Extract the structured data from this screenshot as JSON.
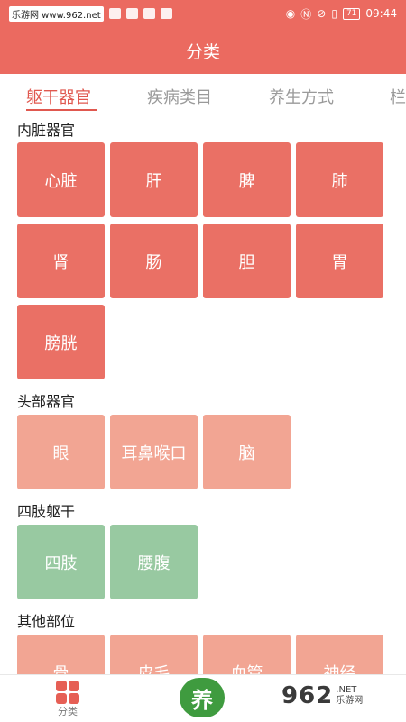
{
  "statusbar": {
    "site_tag": "乐游网 www.962.net",
    "time": "09:44",
    "battery": "71"
  },
  "appbar": {
    "title": "分类"
  },
  "tabs": [
    {
      "label": "躯干器官"
    },
    {
      "label": "疾病类目"
    },
    {
      "label": "养生方式"
    },
    {
      "label": "栏"
    }
  ],
  "sections": [
    {
      "title": "内脏器官",
      "items": [
        "心脏",
        "肝",
        "脾",
        "肺",
        "肾",
        "肠",
        "胆",
        "胃",
        "膀胱"
      ]
    },
    {
      "title": "头部器官",
      "items": [
        "眼",
        "耳鼻喉口",
        "脑"
      ]
    },
    {
      "title": "四肢躯干",
      "items": [
        "四肢",
        "腰腹"
      ]
    },
    {
      "title": "其他部位",
      "items": [
        "骨",
        "皮毛",
        "血管",
        "神经"
      ]
    }
  ],
  "bottom_nav": {
    "category_label": "分类",
    "center_label": "养"
  },
  "watermark": {
    "number": "962",
    "suffix": ".NET",
    "sub": "乐游网"
  },
  "colors": {
    "primary": "#eb6a60",
    "tile_red": "#ea7065",
    "tile_pink": "#f2a593",
    "tile_green": "#98c9a1"
  },
  "icons": {
    "nav_category": "grid-four-squares-icon",
    "center": "yang-logo-icon"
  }
}
